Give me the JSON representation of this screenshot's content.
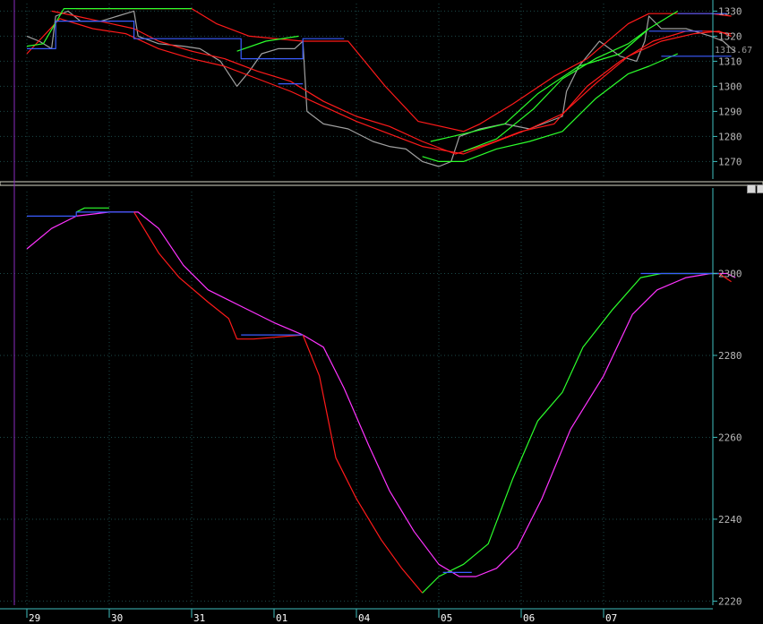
{
  "colors": {
    "background": "#000000",
    "grid": "#1c4a4a",
    "axis": "#3fbfbf",
    "price": "#a0a0a0",
    "red": "#ff1a1a",
    "green": "#2cff2c",
    "blue": "#3a5cff",
    "magenta": "#ff33ff",
    "cursor": "#8a2bbf"
  },
  "x_axis": {
    "date_labels": [
      "29",
      "30",
      "31",
      "01",
      "04",
      "05",
      "06",
      "07"
    ]
  },
  "chart_data": [
    {
      "type": "line",
      "panel": "price",
      "y_ticks": [
        1270,
        1280,
        1290,
        1300,
        1310,
        1320,
        1330
      ],
      "ylim": [
        1263,
        1333
      ],
      "last_value_label": "1313.67",
      "x_domain": [
        0,
        8.65
      ],
      "series": [
        {
          "color": "#a0a0a0",
          "points": [
            [
              0,
              1320
            ],
            [
              0.15,
              1318
            ],
            [
              0.3,
              1315
            ],
            [
              0.35,
              1328
            ],
            [
              0.5,
              1330
            ],
            [
              0.65,
              1326
            ],
            [
              0.9,
              1326
            ],
            [
              1.1,
              1328
            ],
            [
              1.3,
              1330
            ],
            [
              1.35,
              1320
            ],
            [
              1.6,
              1317
            ],
            [
              1.9,
              1316
            ],
            [
              2.1,
              1315
            ],
            [
              2.35,
              1310
            ],
            [
              2.55,
              1300
            ],
            [
              2.7,
              1306
            ],
            [
              2.85,
              1313
            ],
            [
              3.05,
              1315
            ],
            [
              3.25,
              1315
            ],
            [
              3.35,
              1318
            ],
            [
              3.4,
              1290
            ],
            [
              3.6,
              1285
            ],
            [
              3.9,
              1283
            ],
            [
              4.2,
              1278
            ],
            [
              4.4,
              1276
            ],
            [
              4.6,
              1275
            ],
            [
              4.8,
              1270
            ],
            [
              5.0,
              1268
            ],
            [
              5.15,
              1270
            ],
            [
              5.25,
              1280
            ],
            [
              5.5,
              1283
            ],
            [
              5.8,
              1285
            ],
            [
              6.1,
              1283
            ],
            [
              6.5,
              1288
            ],
            [
              6.55,
              1298
            ],
            [
              6.7,
              1308
            ],
            [
              6.95,
              1318
            ],
            [
              7.2,
              1312
            ],
            [
              7.4,
              1310
            ],
            [
              7.5,
              1318
            ],
            [
              7.55,
              1328
            ],
            [
              7.7,
              1323
            ],
            [
              8.0,
              1323
            ],
            [
              8.3,
              1320
            ],
            [
              8.45,
              1318
            ],
            [
              8.6,
              1313.67
            ]
          ]
        },
        {
          "color": "#ff1a1a",
          "points": [
            [
              0.3,
              1330
            ],
            [
              0.6,
              1328
            ],
            [
              1.3,
              1323
            ],
            [
              1.6,
              1318
            ],
            [
              2.0,
              1314
            ],
            [
              2.4,
              1311
            ],
            [
              2.8,
              1306
            ],
            [
              3.2,
              1302
            ],
            [
              3.6,
              1294
            ],
            [
              4.0,
              1288
            ],
            [
              4.4,
              1284
            ],
            [
              4.8,
              1278
            ],
            [
              5.2,
              1273
            ],
            [
              5.6,
              1277
            ],
            [
              6.0,
              1282
            ],
            [
              6.4,
              1285
            ],
            [
              6.8,
              1300
            ],
            [
              7.2,
              1310
            ],
            [
              7.6,
              1318
            ],
            [
              8.0,
              1322
            ],
            [
              8.3,
              1322
            ],
            [
              8.55,
              1321
            ]
          ]
        },
        {
          "color": "#ff1a1a",
          "points": [
            [
              0,
              1313
            ],
            [
              0.4,
              1327
            ],
            [
              0.8,
              1323
            ],
            [
              1.2,
              1321
            ],
            [
              1.6,
              1315
            ],
            [
              2.0,
              1311
            ],
            [
              2.4,
              1308
            ],
            [
              2.8,
              1303
            ],
            [
              3.2,
              1298
            ],
            [
              3.6,
              1292
            ],
            [
              4.0,
              1286
            ],
            [
              4.4,
              1281
            ],
            [
              4.8,
              1276
            ],
            [
              5.3,
              1273
            ],
            [
              5.7,
              1278
            ],
            [
              6.1,
              1283
            ],
            [
              6.5,
              1289
            ],
            [
              6.9,
              1301
            ],
            [
              7.3,
              1312
            ],
            [
              7.7,
              1318
            ],
            [
              8.1,
              1321
            ],
            [
              8.4,
              1322
            ],
            [
              8.55,
              1320
            ]
          ]
        },
        {
          "color": "#ff1a1a",
          "points": [
            [
              0.6,
              1331
            ],
            [
              2.0,
              1331
            ],
            [
              2.3,
              1325
            ],
            [
              2.7,
              1320
            ],
            [
              3.35,
              1318
            ],
            [
              3.9,
              1318
            ],
            [
              4.35,
              1300
            ],
            [
              4.75,
              1286
            ],
            [
              5.3,
              1282
            ],
            [
              5.5,
              1285
            ],
            [
              5.9,
              1293
            ],
            [
              6.4,
              1304
            ],
            [
              6.8,
              1311
            ],
            [
              7.3,
              1325
            ],
            [
              7.55,
              1329
            ],
            [
              7.8,
              1329
            ],
            [
              8.3,
              1329
            ],
            [
              8.55,
              1328
            ]
          ]
        },
        {
          "color": "#2cff2c",
          "points": [
            [
              0,
              1316
            ],
            [
              0.2,
              1317
            ],
            [
              0.45,
              1331
            ],
            [
              0.8,
              1331
            ],
            [
              1.3,
              1331
            ],
            [
              1.6,
              1331
            ],
            [
              2.0,
              1331
            ]
          ]
        },
        {
          "color": "#2cff2c",
          "points": [
            [
              2.55,
              1314
            ],
            [
              2.9,
              1318
            ],
            [
              3.3,
              1320
            ]
          ]
        },
        {
          "color": "#2cff2c",
          "points": [
            [
              4.8,
              1272
            ],
            [
              5.0,
              1270
            ],
            [
              5.3,
              1270
            ],
            [
              5.7,
              1275
            ],
            [
              6.1,
              1278
            ],
            [
              6.5,
              1282
            ],
            [
              6.9,
              1295
            ],
            [
              7.3,
              1305
            ],
            [
              7.55,
              1308
            ],
            [
              7.9,
              1313
            ]
          ]
        },
        {
          "color": "#2cff2c",
          "points": [
            [
              4.9,
              1278
            ],
            [
              5.3,
              1281
            ],
            [
              5.8,
              1285
            ],
            [
              6.2,
              1297
            ],
            [
              6.7,
              1308
            ],
            [
              7.2,
              1313
            ],
            [
              7.55,
              1323
            ],
            [
              7.9,
              1330
            ]
          ]
        },
        {
          "color": "#2cff2c",
          "points": [
            [
              5.3,
              1274
            ],
            [
              5.7,
              1279
            ],
            [
              6.15,
              1291
            ],
            [
              6.5,
              1303
            ],
            [
              6.9,
              1311
            ],
            [
              7.3,
              1317
            ],
            [
              7.55,
              1323
            ]
          ]
        },
        {
          "color": "#3a5cff",
          "points": [
            [
              0,
              1315
            ],
            [
              0.35,
              1315
            ],
            [
              0.35,
              1326
            ],
            [
              1.3,
              1326
            ],
            [
              1.3,
              1319
            ],
            [
              2.6,
              1319
            ],
            [
              2.6,
              1311
            ],
            [
              3.35,
              1311
            ],
            [
              3.35,
              1319
            ],
            [
              3.85,
              1319
            ]
          ]
        },
        {
          "color": "#3a5cff",
          "points": [
            [
              3.05,
              1301
            ],
            [
              3.35,
              1301
            ]
          ]
        },
        {
          "color": "#3a5cff",
          "points": [
            [
              7.55,
              1322
            ],
            [
              8.2,
              1322
            ]
          ]
        },
        {
          "color": "#3a5cff",
          "points": [
            [
              7.9,
              1329
            ],
            [
              8.5,
              1329
            ]
          ]
        },
        {
          "color": "#3a5cff",
          "points": [
            [
              7.7,
              1312
            ],
            [
              8.55,
              1312
            ]
          ]
        }
      ]
    },
    {
      "type": "line",
      "panel": "indicator",
      "y_ticks": [
        2220,
        2240,
        2260,
        2280,
        2300
      ],
      "ylim": [
        2219,
        2320
      ],
      "x_domain": [
        0,
        8.65
      ],
      "series": [
        {
          "color": "#ff33ff",
          "points": [
            [
              0,
              2306
            ],
            [
              0.3,
              2311
            ],
            [
              0.6,
              2314
            ],
            [
              1.0,
              2315
            ],
            [
              1.35,
              2315
            ],
            [
              1.6,
              2311
            ],
            [
              1.9,
              2302
            ],
            [
              2.2,
              2296
            ],
            [
              2.6,
              2292
            ],
            [
              3.0,
              2288
            ],
            [
              3.35,
              2285
            ],
            [
              3.6,
              2282
            ],
            [
              3.85,
              2272
            ],
            [
              4.15,
              2258
            ],
            [
              4.4,
              2247
            ],
            [
              4.7,
              2237
            ],
            [
              5.0,
              2229
            ],
            [
              5.25,
              2226
            ],
            [
              5.45,
              2226
            ],
            [
              5.7,
              2228
            ],
            [
              5.95,
              2233
            ],
            [
              6.25,
              2245
            ],
            [
              6.6,
              2262
            ],
            [
              7.0,
              2275
            ],
            [
              7.35,
              2290
            ],
            [
              7.65,
              2296
            ],
            [
              8.0,
              2299
            ],
            [
              8.3,
              2300
            ],
            [
              8.5,
              2300
            ],
            [
              8.6,
              2299
            ]
          ]
        },
        {
          "color": "#ff1a1a",
          "points": [
            [
              1.3,
              2315
            ],
            [
              1.6,
              2305
            ],
            [
              1.85,
              2299
            ],
            [
              2.2,
              2293
            ],
            [
              2.45,
              2289
            ],
            [
              2.55,
              2284
            ],
            [
              2.75,
              2284
            ],
            [
              3.35,
              2285
            ],
            [
              3.55,
              2275
            ],
            [
              3.75,
              2255
            ],
            [
              4.0,
              2245
            ],
            [
              4.3,
              2235
            ],
            [
              4.55,
              2228
            ],
            [
              4.8,
              2222
            ]
          ]
        },
        {
          "color": "#2cff2c",
          "points": [
            [
              4.8,
              2222
            ],
            [
              5.0,
              2226
            ],
            [
              5.3,
              2229
            ],
            [
              5.6,
              2234
            ],
            [
              5.9,
              2250
            ],
            [
              6.2,
              2264
            ],
            [
              6.5,
              2271
            ],
            [
              6.75,
              2282
            ],
            [
              7.1,
              2291
            ],
            [
              7.45,
              2299
            ],
            [
              7.7,
              2300
            ],
            [
              8.4,
              2300
            ]
          ]
        },
        {
          "color": "#2cff2c",
          "points": [
            [
              0.6,
              2315
            ],
            [
              0.7,
              2316
            ],
            [
              1.0,
              2316
            ]
          ]
        },
        {
          "color": "#3a5cff",
          "points": [
            [
              0,
              2314
            ],
            [
              0.6,
              2314
            ],
            [
              0.6,
              2315
            ],
            [
              1.3,
              2315
            ]
          ]
        },
        {
          "color": "#3a5cff",
          "points": [
            [
              2.6,
              2285
            ],
            [
              3.35,
              2285
            ]
          ]
        },
        {
          "color": "#3a5cff",
          "points": [
            [
              5.05,
              2227
            ],
            [
              5.4,
              2227
            ]
          ]
        },
        {
          "color": "#3a5cff",
          "points": [
            [
              7.45,
              2300
            ],
            [
              8.4,
              2300
            ]
          ]
        },
        {
          "color": "#ff1a1a",
          "points": [
            [
              8.4,
              2300
            ],
            [
              8.55,
              2298
            ]
          ]
        }
      ]
    }
  ]
}
